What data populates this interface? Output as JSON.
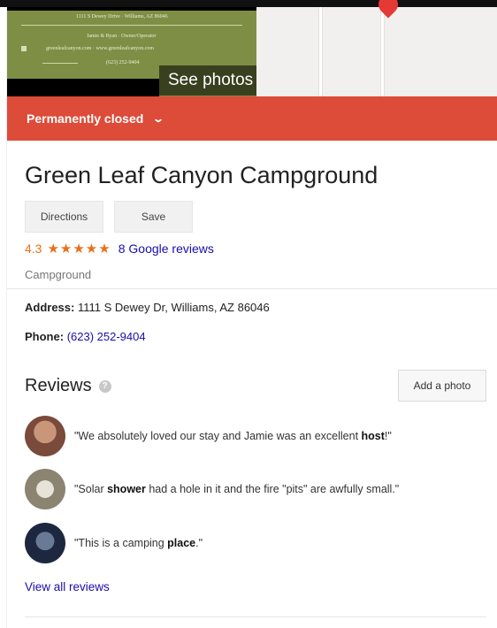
{
  "hero": {
    "see_photos_label": "See photos",
    "photo_lines": [
      "1111 S Dewey Drive · Williams, AZ 86046",
      "Jamie & Ryan · Owner/Operator",
      "greenleafcanyon.com · www.greenleafcanyon.com",
      "(623) 252-9404"
    ]
  },
  "status_banner": {
    "label": "Permanently closed",
    "icon": "chevron-down-icon",
    "color": "#dd4b39"
  },
  "place": {
    "name": "Green Leaf Canyon Campground",
    "directions_label": "Directions",
    "save_label": "Save",
    "rating": "4.3",
    "rating_value": 4.3,
    "stars": "★★★★★",
    "reviews_link": "8 Google reviews",
    "category": "Campground"
  },
  "details": {
    "address_label": "Address:",
    "address_value": "1111 S Dewey Dr, Williams, AZ 86046",
    "phone_label": "Phone:",
    "phone_value": "(623) 252-9404"
  },
  "reviews": {
    "heading": "Reviews",
    "add_photo_label": "Add a photo",
    "items": [
      {
        "pre": "\"We absolutely loved our stay and Jamie was an excellent ",
        "bold": "host",
        "post": "!\""
      },
      {
        "pre": "\"Solar ",
        "bold": "shower",
        "post": " had a hole in it and the fire \"pits\" are awfully small.\""
      },
      {
        "pre": "\"This is a camping ",
        "bold": "place",
        "post": ".\""
      }
    ],
    "view_all_label": "View all reviews"
  },
  "colors": {
    "accent_orange": "#e7711b",
    "link_blue": "#1a0dab",
    "banner_red": "#dd4b39"
  }
}
